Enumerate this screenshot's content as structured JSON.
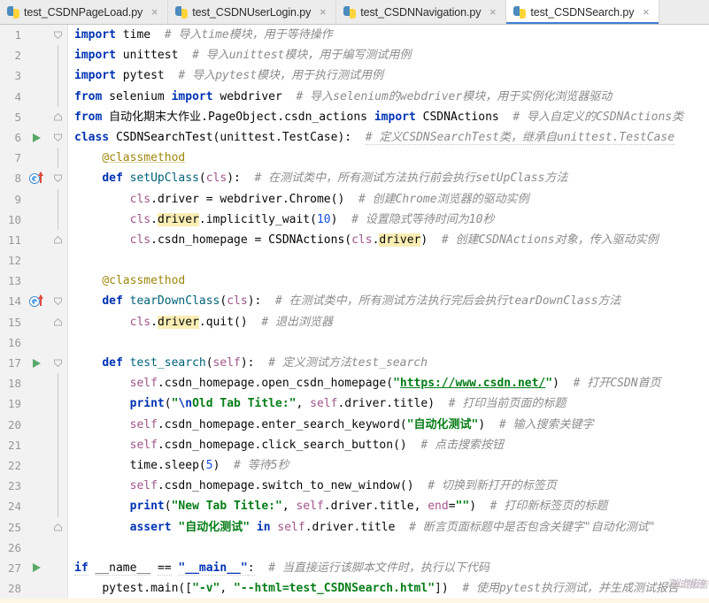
{
  "window": {
    "title": "test_CSDNSearch.py"
  },
  "tabs": [
    {
      "label": "test_CSDNPageLoad.py",
      "icon": "python-file-icon",
      "close": "×",
      "active": false
    },
    {
      "label": "test_CSDNUserLogin.py",
      "icon": "python-file-icon",
      "close": "×",
      "active": false
    },
    {
      "label": "test_CSDNNavigation.py",
      "icon": "python-file-icon",
      "close": "×",
      "active": false
    },
    {
      "label": "test_CSDNSearch.py",
      "icon": "python-file-icon",
      "close": "×",
      "active": true
    }
  ],
  "editor": {
    "language": "python",
    "accent_color": "#3b7fd4",
    "gutter_bg": "#f2f2f2",
    "run_marker_color": "#59a869",
    "override_marker_color": "#5aa5e8",
    "highlight_color": "#faeeb4",
    "line_numbers": [
      1,
      2,
      3,
      4,
      5,
      6,
      7,
      8,
      9,
      10,
      11,
      12,
      13,
      14,
      15,
      16,
      17,
      18,
      19,
      20,
      21,
      22,
      23,
      24,
      25,
      26,
      27,
      28
    ],
    "lines": [
      {
        "n": 1,
        "text": "import time  # 导入time模块，用于等待操作"
      },
      {
        "n": 2,
        "text": "import unittest  # 导入unittest模块，用于编写测试用例"
      },
      {
        "n": 3,
        "text": "import pytest  # 导入pytest模块，用于执行测试用例"
      },
      {
        "n": 4,
        "text": "from selenium import webdriver  # 导入selenium的webdriver模块，用于实例化浏览器驱动"
      },
      {
        "n": 5,
        "text": "from 自动化期末大作业.PageObject.csdn_actions import CSDNActions  # 导入自定义的CSDNActions类"
      },
      {
        "n": 6,
        "text": "class CSDNSearchTest(unittest.TestCase):  # 定义CSDNSearchTest类，继承自unittest.TestCase"
      },
      {
        "n": 7,
        "text": "    @classmethod"
      },
      {
        "n": 8,
        "text": "    def setUpClass(cls):  # 在测试类中，所有测试方法执行前会执行setUpClass方法"
      },
      {
        "n": 9,
        "text": "        cls.driver = webdriver.Chrome()  # 创建Chrome浏览器的驱动实例"
      },
      {
        "n": 10,
        "text": "        cls.driver.implicitly_wait(10)  # 设置隐式等待时间为10秒"
      },
      {
        "n": 11,
        "text": "        cls.csdn_homepage = CSDNActions(cls.driver)  # 创建CSDNActions对象，传入驱动实例"
      },
      {
        "n": 12,
        "text": ""
      },
      {
        "n": 13,
        "text": "    @classmethod"
      },
      {
        "n": 14,
        "text": "    def tearDownClass(cls):  # 在测试类中，所有测试方法执行完后会执行tearDownClass方法"
      },
      {
        "n": 15,
        "text": "        cls.driver.quit()  # 退出浏览器"
      },
      {
        "n": 16,
        "text": ""
      },
      {
        "n": 17,
        "text": "    def test_search(self):  # 定义测试方法test_search"
      },
      {
        "n": 18,
        "text": "        self.csdn_homepage.open_csdn_homepage(\"https://www.csdn.net/\")  # 打开CSDN首页"
      },
      {
        "n": 19,
        "text": "        print(\"\\nOld Tab Title:\", self.driver.title)  # 打印当前页面的标题"
      },
      {
        "n": 20,
        "text": "        self.csdn_homepage.enter_search_keyword(\"自动化测试\")  # 输入搜索关键字"
      },
      {
        "n": 21,
        "text": "        self.csdn_homepage.click_search_button()  # 点击搜索按钮"
      },
      {
        "n": 22,
        "text": "        time.sleep(5)  # 等待5秒"
      },
      {
        "n": 23,
        "text": "        self.csdn_homepage.switch_to_new_window()  # 切换到新打开的标签页"
      },
      {
        "n": 24,
        "text": "        print(\"New Tab Title:\", self.driver.title, end=\"\")  # 打印新标签页的标题"
      },
      {
        "n": 25,
        "text": "        assert \"自动化测试\" in self.driver.title  # 断言页面标题中是否包含关键字\"自动化测试\""
      },
      {
        "n": 26,
        "text": ""
      },
      {
        "n": 27,
        "text": "if __name__ == \"__main__\":  # 当直接运行该脚本文件时，执行以下代码"
      },
      {
        "n": 28,
        "text": "    pytest.main([\"-v\", \"--html=test_CSDNSearch.html\"])  # 使用pytest执行测试，并生成测试报告"
      }
    ],
    "run_marker_lines": [
      6,
      17,
      27
    ],
    "override_marker_lines": [
      8,
      14
    ]
  },
  "watermark": {
    "text_back": "测试报告",
    "text_front": "测试报告"
  }
}
